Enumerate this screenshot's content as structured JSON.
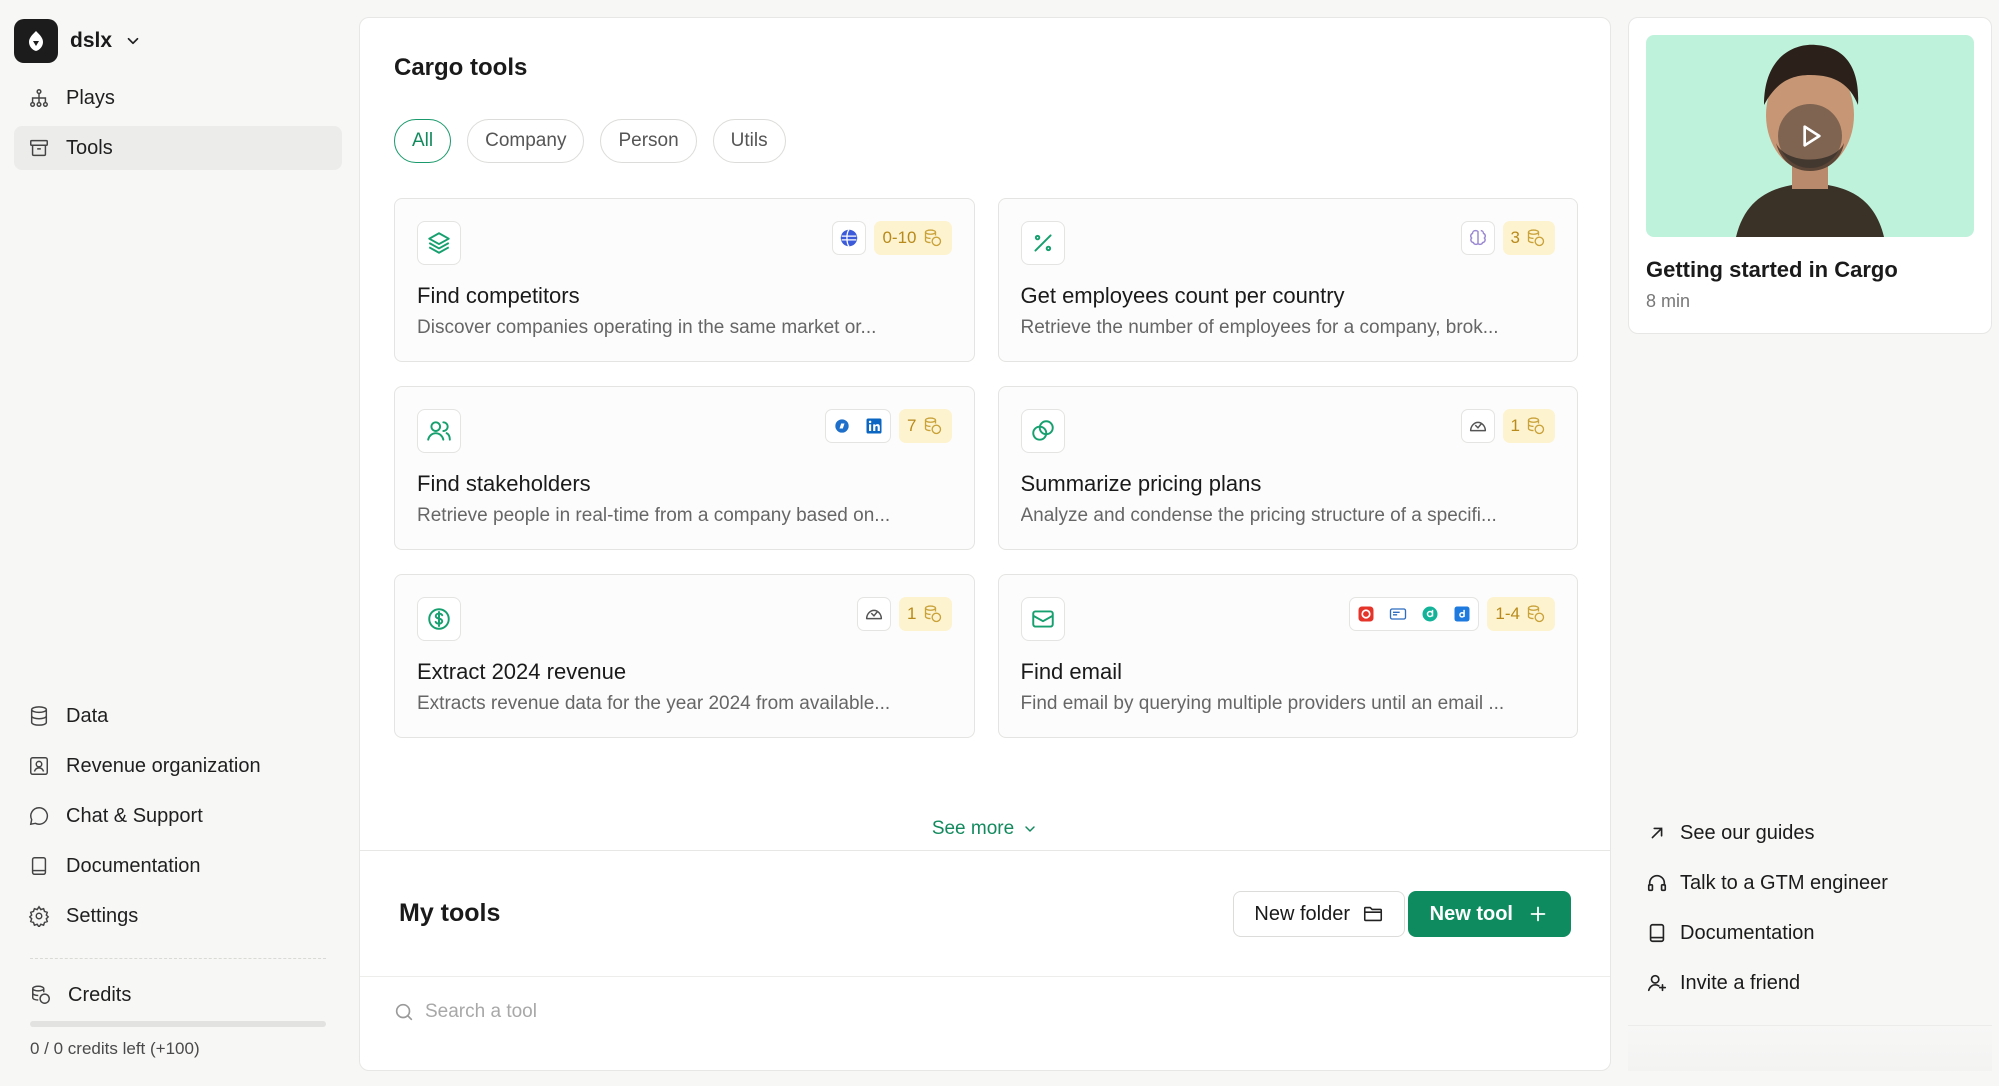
{
  "workspace": {
    "name": "dslx"
  },
  "nav": {
    "top": [
      {
        "label": "Plays",
        "icon": "hierarchy-icon"
      },
      {
        "label": "Tools",
        "icon": "archive-icon",
        "active": true
      }
    ],
    "bottom": [
      {
        "label": "Data",
        "icon": "database-icon"
      },
      {
        "label": "Revenue organization",
        "icon": "contact-card-icon"
      },
      {
        "label": "Chat & Support",
        "icon": "chat-bubble-icon"
      },
      {
        "label": "Documentation",
        "icon": "book-icon"
      },
      {
        "label": "Settings",
        "icon": "gear-icon"
      }
    ]
  },
  "credits": {
    "label": "Credits",
    "status": "0 / 0 credits left (+100)",
    "fraction_used": 0
  },
  "cargo_tools": {
    "title": "Cargo tools",
    "filters": [
      "All",
      "Company",
      "Person",
      "Utils"
    ],
    "active_filter": "All",
    "cards": [
      {
        "title": "Find competitors",
        "description": "Discover companies operating in the same market or...",
        "cost": "0-10",
        "icon": "layers-icon"
      },
      {
        "title": "Get employees count per country",
        "description": "Retrieve the number of employees for a company, brok...",
        "cost": "3",
        "icon": "percent-icon"
      },
      {
        "title": "Find stakeholders",
        "description": "Retrieve people in real-time from a company based on...",
        "cost": "7",
        "icon": "users-icon"
      },
      {
        "title": "Summarize pricing plans",
        "description": "Analyze and condense the pricing structure of a specifi...",
        "cost": "1",
        "icon": "coins-icon"
      },
      {
        "title": "Extract 2024 revenue",
        "description": "Extracts revenue data for the year 2024 from available...",
        "cost": "1",
        "icon": "dollar-circle-icon"
      },
      {
        "title": "Find email",
        "description": "Find email by querying multiple providers until an email ...",
        "cost": "1-4",
        "icon": "mail-icon"
      }
    ],
    "see_more": "See more"
  },
  "my_tools": {
    "title": "My tools",
    "new_folder": "New folder",
    "new_tool": "New tool",
    "search_placeholder": "Search a tool"
  },
  "video": {
    "title": "Getting started in Cargo",
    "duration": "8 min"
  },
  "links": [
    {
      "label": "See our guides",
      "icon": "arrow-up-right-icon"
    },
    {
      "label": "Talk to a GTM engineer",
      "icon": "headphones-icon"
    },
    {
      "label": "Documentation",
      "icon": "book-icon"
    },
    {
      "label": "Invite a friend",
      "icon": "user-plus-icon"
    }
  ],
  "colors": {
    "accent": "#0f8c5f",
    "cost_bg": "#fdf3cf",
    "cost_text": "#b88a1b",
    "thumb_bg": "#bff2db"
  }
}
